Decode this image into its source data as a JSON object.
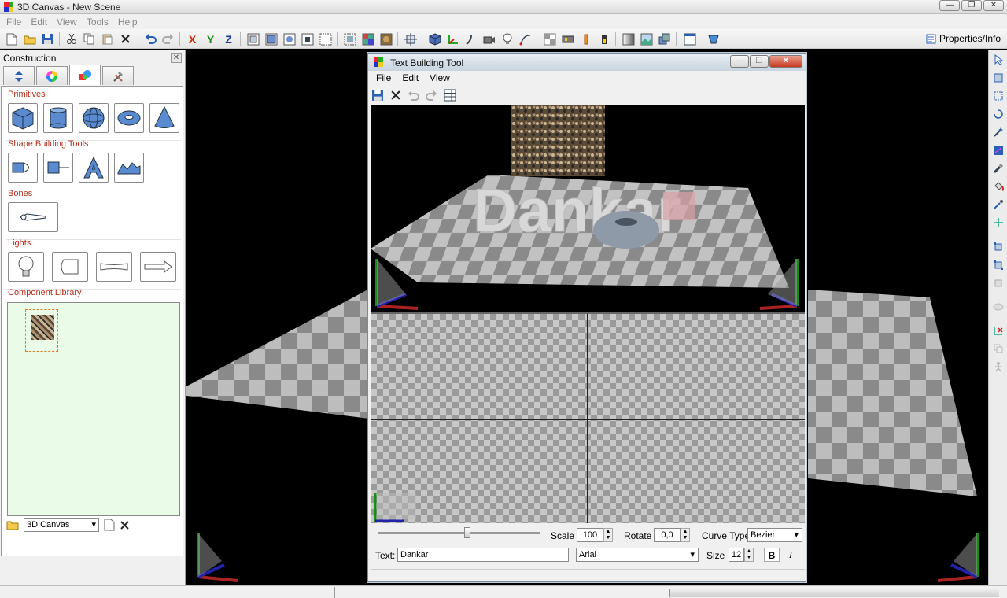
{
  "window": {
    "title": "3D Canvas - New Scene"
  },
  "menu": [
    "File",
    "Edit",
    "View",
    "Tools",
    "Help"
  ],
  "toolbar": {
    "props_label": "Properties/Info"
  },
  "construction": {
    "title": "Construction",
    "sections": {
      "primitives": "Primitives",
      "shape_tools": "Shape Building Tools",
      "bones": "Bones",
      "lights": "Lights",
      "library": "Component Library"
    },
    "library_select": "3D Canvas"
  },
  "dialog": {
    "title": "Text Building Tool",
    "menu": [
      "File",
      "Edit",
      "View"
    ],
    "scene_text": "Dankar",
    "scale_label": "Scale",
    "scale_value": "100",
    "rotate_label": "Rotate",
    "rotate_value": "0,0",
    "curve_label": "Curve Type",
    "curve_value": "Bezier",
    "text_label": "Text:",
    "text_value": "Dankar",
    "font_value": "Arial",
    "size_label": "Size",
    "size_value": "12",
    "bold_label": "B",
    "italic_label": "I"
  },
  "colors": {
    "section_label": "#b0301c",
    "library_bg": "#eafbe8",
    "accent_red": "#cc2200",
    "accent_green": "#1a8a1a",
    "accent_blue": "#1a3a9a"
  },
  "slider_fraction": 0.55
}
